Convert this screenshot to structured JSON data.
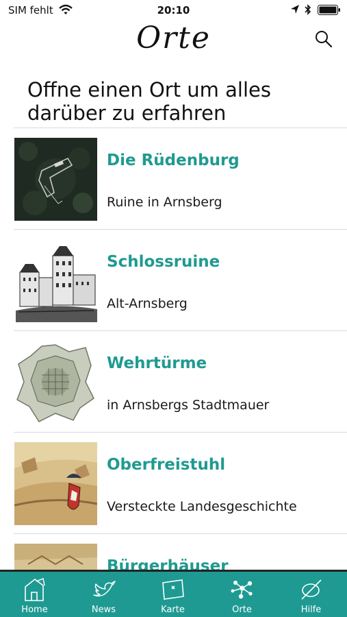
{
  "status_bar": {
    "carrier": "SIM fehlt",
    "time": "20:10"
  },
  "header": {
    "title": "Orte",
    "search_icon": "search-icon"
  },
  "intro_text": "Offne einen Ort um alles darüber zu erfahren",
  "places": [
    {
      "title": "Die Rüdenburg",
      "subtitle": "Ruine in Arnsberg"
    },
    {
      "title": "Schlossruine",
      "subtitle": "Alt-Arnsberg"
    },
    {
      "title": "Wehrtürme",
      "subtitle": "in Arnsbergs Stadtmauer"
    },
    {
      "title": "Oberfreistuhl",
      "subtitle": "Versteckte Landesgeschichte"
    },
    {
      "title": "Bürgerhäuser",
      "subtitle": ""
    }
  ],
  "tabs": [
    {
      "label": "Home",
      "icon": "house-icon"
    },
    {
      "label": "News",
      "icon": "bird-icon"
    },
    {
      "label": "Karte",
      "icon": "map-icon"
    },
    {
      "label": "Orte",
      "icon": "network-icon"
    },
    {
      "label": "Hilfe",
      "icon": "help-icon"
    }
  ],
  "colors": {
    "accent": "#1f9a91",
    "tab_bar": "#1e9a92"
  }
}
